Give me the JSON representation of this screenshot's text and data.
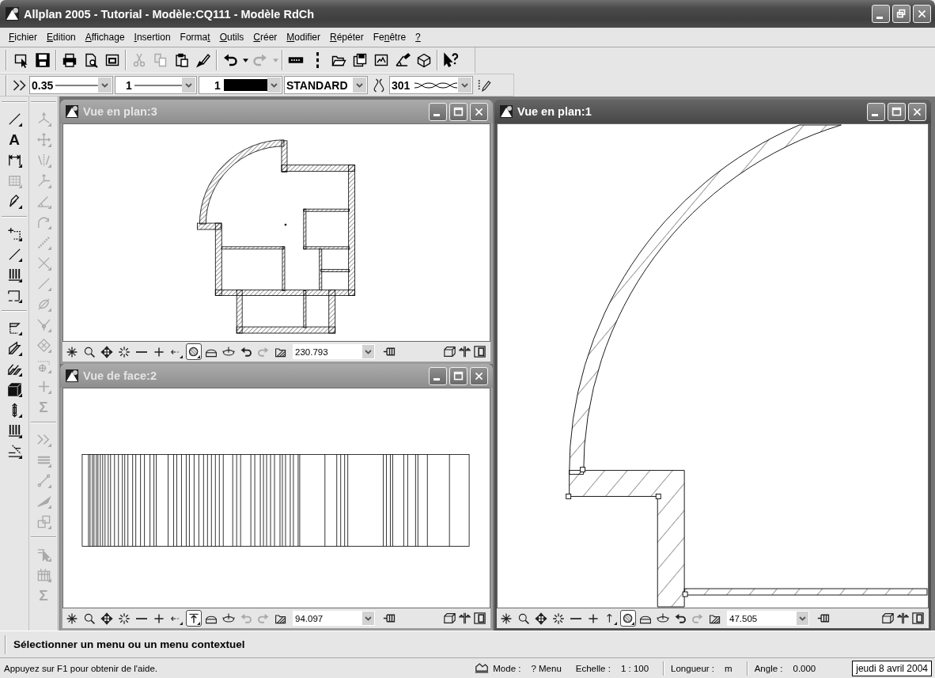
{
  "window": {
    "title": "Allplan 2005 - Tutorial - Modèle:CQ111 - Modèle RdCh"
  },
  "menu": [
    {
      "mnemonic": "F",
      "rest": "ichier"
    },
    {
      "mnemonic": "E",
      "rest": "dition"
    },
    {
      "mnemonic": "A",
      "rest": "ffichage"
    },
    {
      "mnemonic": "I",
      "rest": "nsertion"
    },
    {
      "lead": "Forma",
      "mnemonic": "t"
    },
    {
      "mnemonic": "O",
      "rest": "utils"
    },
    {
      "mnemonic": "C",
      "rest": "réer"
    },
    {
      "mnemonic": "M",
      "rest": "odifier"
    },
    {
      "mnemonic": "R",
      "rest": "épéter"
    },
    {
      "lead": "Fe",
      "mnemonic": "n",
      "rest": "être"
    },
    {
      "mnemonic": "?"
    }
  ],
  "toolbar": [
    [
      {
        "kind": "selection",
        "disabled": false
      },
      {
        "kind": "save",
        "disabled": false
      }
    ],
    [
      {
        "kind": "print",
        "disabled": false
      },
      {
        "kind": "preview",
        "disabled": false
      },
      {
        "kind": "frame",
        "disabled": false
      }
    ],
    [
      {
        "kind": "cut",
        "disabled": true
      },
      {
        "kind": "copy",
        "disabled": true
      },
      {
        "kind": "paste",
        "disabled": false
      },
      {
        "kind": "brush",
        "disabled": false
      }
    ],
    [
      {
        "kind": "undo",
        "disabled": false
      },
      {
        "kind": "caret",
        "disabled": false
      },
      {
        "kind": "redo",
        "disabled": true
      },
      {
        "kind": "caret",
        "disabled": true
      }
    ],
    [
      {
        "kind": "ruler",
        "disabled": false
      },
      {
        "kind": "dots",
        "disabled": false
      },
      {
        "kind": "open",
        "disabled": false
      },
      {
        "kind": "saveall",
        "disabled": false
      },
      {
        "kind": "picture",
        "disabled": false
      },
      {
        "kind": "protractor",
        "disabled": false
      },
      {
        "kind": "box",
        "disabled": false
      }
    ],
    [
      {
        "kind": "help",
        "disabled": false
      }
    ]
  ],
  "format_bar": {
    "thickness": "0.35",
    "line": "1",
    "pen_number": "1",
    "layer": "STANDARD",
    "pattern": "301"
  },
  "palette": [
    [
      [
        {
          "kind": "line",
          "disabled": false
        },
        {
          "kind": "text",
          "glyph": "A",
          "disabled": false
        },
        {
          "kind": "dimension",
          "disabled": false
        },
        {
          "kind": "grid",
          "disabled": true
        },
        {
          "kind": "pen",
          "disabled": false
        }
      ],
      [
        {
          "kind": "offset",
          "disabled": false
        },
        {
          "kind": "line",
          "disabled": false
        },
        {
          "kind": "stripes",
          "disabled": false
        },
        {
          "kind": "bracket",
          "disabled": false
        }
      ],
      [
        {
          "kind": "slab",
          "disabled": false
        },
        {
          "kind": "wall",
          "disabled": false
        },
        {
          "kind": "walls",
          "disabled": false
        },
        {
          "kind": "cube",
          "disabled": false
        },
        {
          "kind": "height",
          "disabled": false
        },
        {
          "kind": "stripes",
          "disabled": false
        },
        {
          "kind": "stair",
          "disabled": false
        }
      ]
    ],
    [
      [
        {
          "kind": "axes",
          "disabled": true
        },
        {
          "kind": "move",
          "disabled": true
        },
        {
          "kind": "mirror",
          "disabled": true
        },
        {
          "kind": "rotate",
          "disabled": true
        },
        {
          "kind": "angle",
          "disabled": true
        },
        {
          "kind": "arc",
          "disabled": true
        },
        {
          "kind": "dashline",
          "disabled": true
        },
        {
          "kind": "cross",
          "disabled": true
        },
        {
          "kind": "line",
          "disabled": true
        },
        {
          "kind": "ellipse",
          "disabled": true
        },
        {
          "kind": "intersect",
          "disabled": true
        },
        {
          "kind": "diamond",
          "disabled": true
        },
        {
          "kind": "target",
          "disabled": true
        },
        {
          "kind": "plus",
          "disabled": true
        },
        {
          "kind": "sum",
          "glyph": "Σ",
          "disabled": true
        }
      ],
      [
        {
          "kind": "chevrons",
          "disabled": true
        },
        {
          "kind": "parallel",
          "disabled": true
        },
        {
          "kind": "segment",
          "disabled": true
        },
        {
          "kind": "wedge",
          "disabled": true
        },
        {
          "kind": "boxes",
          "disabled": true
        }
      ],
      [
        {
          "kind": "pointer",
          "disabled": true
        },
        {
          "kind": "table",
          "disabled": true
        },
        {
          "kind": "sum",
          "glyph": "Σ",
          "disabled": true
        }
      ]
    ]
  ],
  "views": [
    {
      "title": "Vue en plan:3",
      "active": false,
      "kind": "plan",
      "zoom": "230.793",
      "tools": [
        {
          "kind": "asterisk",
          "pressed": false,
          "disabled": false
        },
        {
          "kind": "zoom",
          "pressed": false,
          "disabled": false
        },
        {
          "kind": "pan",
          "pressed": false,
          "disabled": false
        },
        {
          "kind": "sparkle",
          "pressed": false,
          "disabled": false
        },
        {
          "kind": "minus",
          "pressed": false,
          "disabled": false
        },
        {
          "kind": "plus",
          "pressed": false,
          "disabled": false
        },
        {
          "kind": "back",
          "pressed": false,
          "disabled": false
        },
        {
          "kind": "hatch",
          "pressed": true,
          "disabled": false
        },
        {
          "kind": "dome",
          "pressed": false,
          "disabled": false
        },
        {
          "kind": "orbit",
          "pressed": false,
          "disabled": false
        },
        {
          "kind": "undo",
          "pressed": false,
          "disabled": false
        },
        {
          "kind": "redo",
          "pressed": false,
          "disabled": true
        },
        {
          "kind": "folder",
          "pressed": false,
          "disabled": false
        }
      ]
    },
    {
      "title": "Vue de face:2",
      "active": false,
      "kind": "elevation",
      "zoom": "94.097",
      "tools": [
        {
          "kind": "asterisk",
          "pressed": false,
          "disabled": false
        },
        {
          "kind": "zoom",
          "pressed": false,
          "disabled": false
        },
        {
          "kind": "pan",
          "pressed": false,
          "disabled": false
        },
        {
          "kind": "sparkle",
          "pressed": false,
          "disabled": false
        },
        {
          "kind": "minus",
          "pressed": false,
          "disabled": false
        },
        {
          "kind": "plus",
          "pressed": false,
          "disabled": false
        },
        {
          "kind": "back",
          "pressed": false,
          "disabled": false
        },
        {
          "kind": "figure",
          "pressed": true,
          "disabled": false
        },
        {
          "kind": "dome",
          "pressed": false,
          "disabled": false
        },
        {
          "kind": "orbit",
          "pressed": false,
          "disabled": false
        },
        {
          "kind": "undo",
          "pressed": false,
          "disabled": true
        },
        {
          "kind": "redo",
          "pressed": false,
          "disabled": true
        },
        {
          "kind": "folder",
          "pressed": false,
          "disabled": false
        }
      ]
    },
    {
      "title": "Vue en plan:1",
      "active": true,
      "kind": "detail",
      "zoom": "47.505",
      "tools": [
        {
          "kind": "asterisk",
          "pressed": false,
          "disabled": false
        },
        {
          "kind": "zoom",
          "pressed": false,
          "disabled": false
        },
        {
          "kind": "pan",
          "pressed": false,
          "disabled": false
        },
        {
          "kind": "sparkle",
          "pressed": false,
          "disabled": false
        },
        {
          "kind": "minus",
          "pressed": false,
          "disabled": false
        },
        {
          "kind": "plus",
          "pressed": false,
          "disabled": false
        },
        {
          "kind": "up",
          "pressed": false,
          "disabled": false
        },
        {
          "kind": "hatch",
          "pressed": true,
          "disabled": false
        },
        {
          "kind": "dome",
          "pressed": false,
          "disabled": false
        },
        {
          "kind": "orbit",
          "pressed": false,
          "disabled": false
        },
        {
          "kind": "undo",
          "pressed": false,
          "disabled": false
        },
        {
          "kind": "redo",
          "pressed": false,
          "disabled": true
        },
        {
          "kind": "folder",
          "pressed": false,
          "disabled": false
        }
      ]
    }
  ],
  "command_line": "Sélectionner un menu ou un menu contextuel",
  "status_bar": {
    "help": "Appuyez sur F1 pour obtenir de l'aide.",
    "fields": [
      [
        {
          "label": "Mode :",
          "value": "? Menu"
        },
        {
          "label": "Echelle :",
          "value": "1 : 100"
        }
      ],
      [
        {
          "label": "Longueur :",
          "value": "m"
        }
      ],
      [
        {
          "label": "Angle :",
          "value": "0.000"
        }
      ]
    ],
    "date": "jeudi 8 avril 2004"
  }
}
